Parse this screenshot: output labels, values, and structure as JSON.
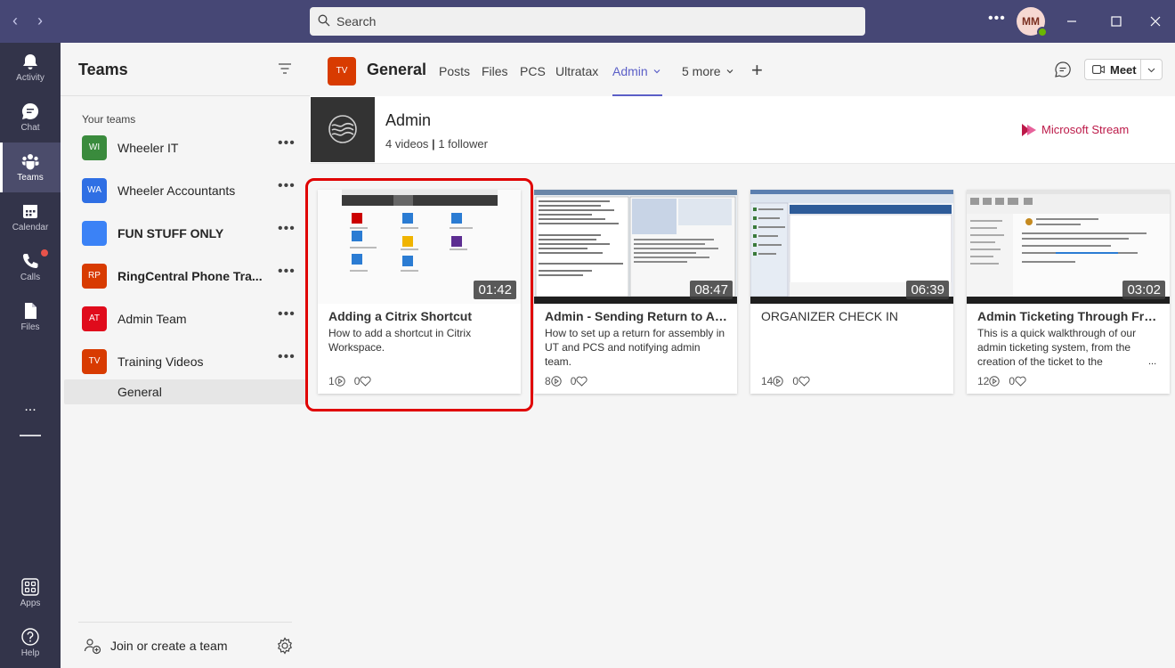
{
  "search": {
    "placeholder": "Search"
  },
  "user": {
    "initials": "MM"
  },
  "rail": {
    "activity": "Activity",
    "chat": "Chat",
    "teams": "Teams",
    "calendar": "Calendar",
    "calls": "Calls",
    "files": "Files",
    "more": "...",
    "apps": "Apps",
    "help": "Help"
  },
  "teams_panel": {
    "title": "Teams",
    "section": "Your teams",
    "teams": [
      {
        "abbr": "WI",
        "name": "Wheeler IT",
        "color": "#3a8b3d",
        "bold": false
      },
      {
        "abbr": "WA",
        "name": "Wheeler Accountants",
        "color": "#2f6fe4",
        "bold": false
      },
      {
        "abbr": "",
        "name": "FUN STUFF ONLY",
        "color": "#3b82f6",
        "bold": true
      },
      {
        "abbr": "RP",
        "name": "RingCentral Phone Tra...",
        "color": "#d83b01",
        "bold": true
      },
      {
        "abbr": "AT",
        "name": "Admin Team",
        "color": "#e00b1c",
        "bold": false
      },
      {
        "abbr": "TV",
        "name": "Training Videos",
        "color": "#d83b01",
        "bold": false
      }
    ],
    "channel": "General",
    "join_label": "Join or create a team"
  },
  "channel": {
    "abbr": "TV",
    "title": "General",
    "tabs": [
      "Posts",
      "Files",
      "PCS",
      "Ultratax",
      "Admin",
      "5 more"
    ],
    "active_tab": "Admin",
    "meet_label": "Meet"
  },
  "banner": {
    "title": "Admin",
    "videos": "4 videos",
    "separator": "|",
    "followers": "1 follower",
    "brand": "Microsoft Stream"
  },
  "videos": [
    {
      "title": "Adding a Citrix Shortcut",
      "desc": "How to add a shortcut in Citrix Workspace.",
      "duration": "01:42",
      "views": "1",
      "likes": "0",
      "ellipsis": ""
    },
    {
      "title": "Admin - Sending Return to As...",
      "desc": "How to set up a return for assembly in UT and PCS and notifying admin team.",
      "duration": "08:47",
      "views": "8",
      "likes": "0",
      "ellipsis": ""
    },
    {
      "title": "ORGANIZER CHECK IN",
      "desc": "",
      "duration": "06:39",
      "views": "14",
      "likes": "0",
      "ellipsis": ""
    },
    {
      "title": "Admin Ticketing Through Fres...",
      "desc": "This is a quick walkthrough of our admin ticketing system, from the creation of the ticket to the",
      "duration": "03:02",
      "views": "12",
      "likes": "0",
      "ellipsis": "..."
    }
  ]
}
